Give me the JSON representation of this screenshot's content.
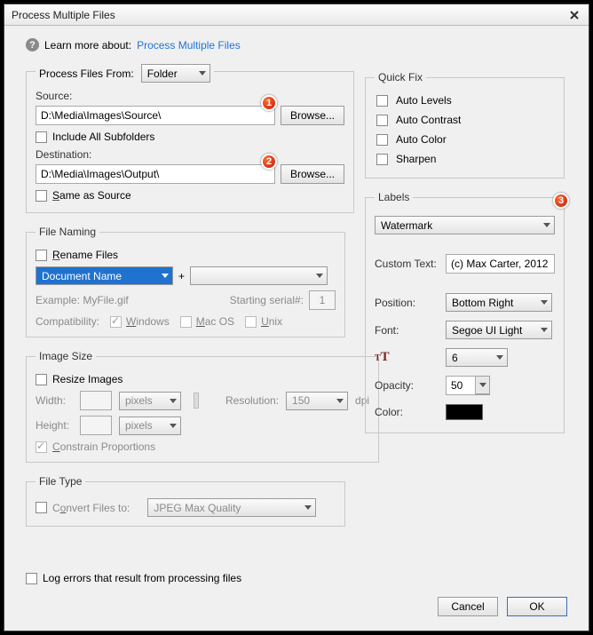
{
  "window": {
    "title": "Process Multiple Files"
  },
  "learn": {
    "prefix": "Learn more about:",
    "link": "Process Multiple Files"
  },
  "processFrom": {
    "label": "Process Files From:",
    "value": "Folder"
  },
  "source": {
    "label": "Source:",
    "path": "D:\\Media\\Images\\Source\\",
    "browse": "Browse...",
    "includeSubfolders": "Include All Subfolders"
  },
  "destination": {
    "label": "Destination:",
    "path": "D:\\Media\\Images\\Output\\",
    "browse": "Browse...",
    "sameAsSource": "Same as Source"
  },
  "fileNaming": {
    "legend": "File Naming",
    "rename": "Rename Files",
    "part1": "Document Name",
    "plus": "+",
    "part2": "",
    "example": "Example: MyFile.gif",
    "serialLabel": "Starting serial#:",
    "serialValue": "1",
    "compatLabel": "Compatibility:",
    "windows": "Windows",
    "mac": "Mac OS",
    "unix": "Unix"
  },
  "imageSize": {
    "legend": "Image Size",
    "resize": "Resize Images",
    "widthLabel": "Width:",
    "heightLabel": "Height:",
    "unit": "pixels",
    "resLabel": "Resolution:",
    "resValue": "150",
    "resUnit": "dpi",
    "constrain": "Constrain Proportions"
  },
  "fileType": {
    "legend": "File Type",
    "convert": "Convert Files to:",
    "value": "JPEG Max Quality"
  },
  "logErrors": "Log errors that result from processing files",
  "quickFix": {
    "legend": "Quick Fix",
    "items": [
      "Auto Levels",
      "Auto Contrast",
      "Auto Color",
      "Sharpen"
    ]
  },
  "labels": {
    "legend": "Labels",
    "type": "Watermark",
    "customLabel": "Custom Text:",
    "customValue": "(c) Max Carter, 2012",
    "positionLabel": "Position:",
    "positionValue": "Bottom Right",
    "fontLabel": "Font:",
    "fontValue": "Segoe UI Light",
    "sizeValue": "6",
    "opacityLabel": "Opacity:",
    "opacityValue": "50",
    "colorLabel": "Color:"
  },
  "buttons": {
    "cancel": "Cancel",
    "ok": "OK"
  },
  "markers": {
    "m1": "1",
    "m2": "2",
    "m3": "3"
  }
}
